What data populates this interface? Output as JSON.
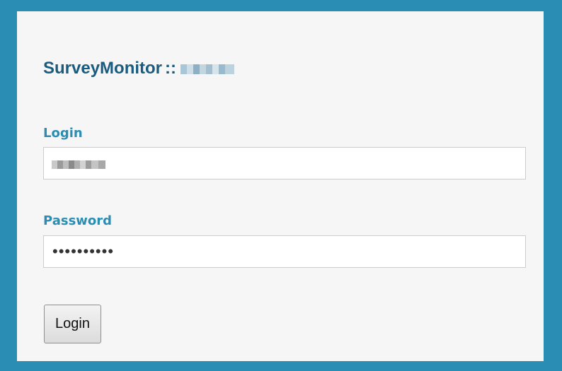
{
  "header": {
    "app_name": "SurveyMonitor",
    "separator": "::",
    "site_name": ""
  },
  "form": {
    "login_label": "Login",
    "login_value": "",
    "password_label": "Password",
    "password_value": "••••••••••",
    "submit_label": "Login"
  },
  "colors": {
    "frame": "#2a8db3",
    "panel": "#f6f6f6",
    "title": "#1a5c80",
    "label": "#2a8db3"
  }
}
